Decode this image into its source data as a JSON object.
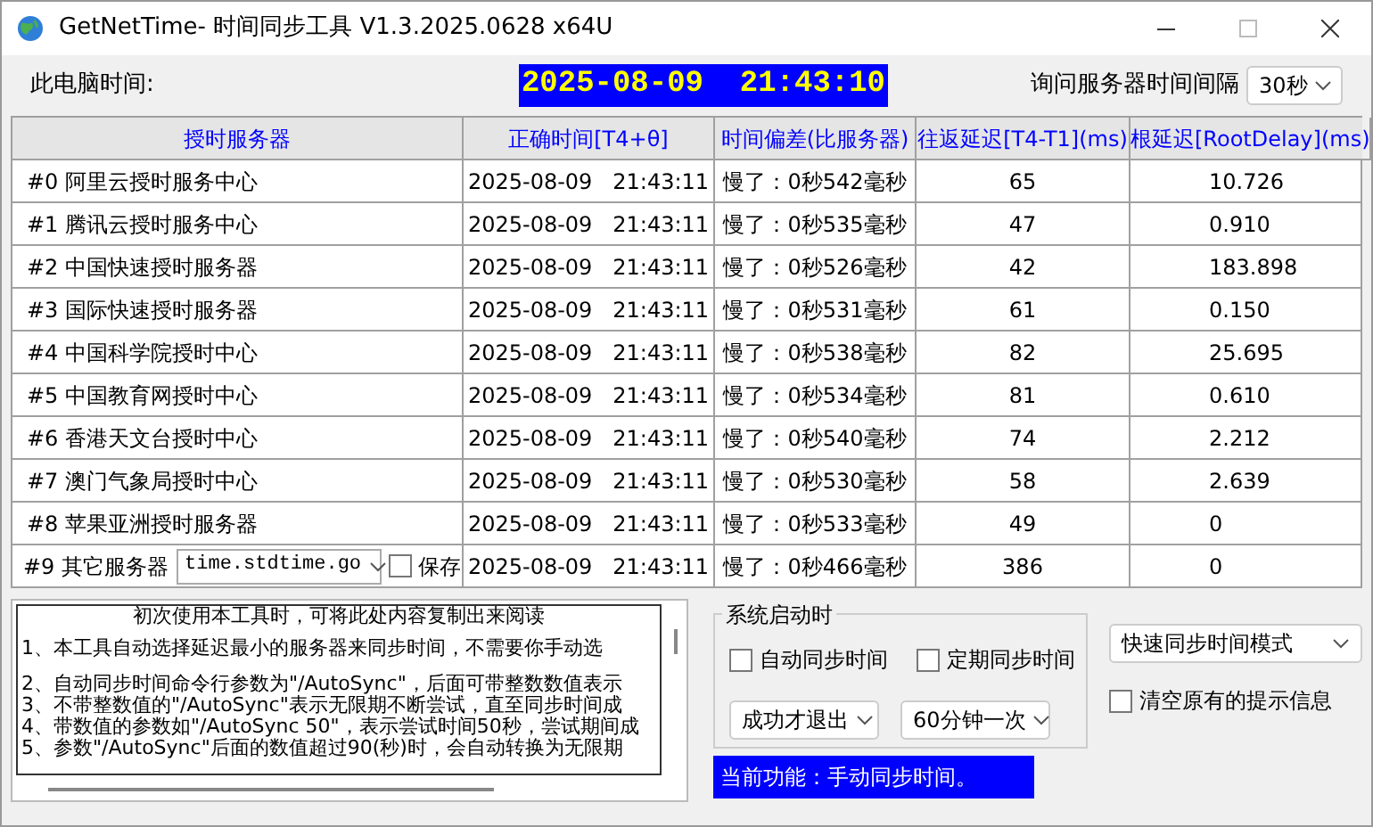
{
  "window": {
    "title": "GetNetTime- 时间同步工具 V1.3.2025.0628 x64U"
  },
  "clock": {
    "label": "此电脑时间:",
    "time": "2025-08-09  21:43:10"
  },
  "interval": {
    "label": "询问服务器时间间隔",
    "value": "30秒"
  },
  "table": {
    "columns": [
      "授时服务器",
      "正确时间[T4+θ]",
      "时间偏差(比服务器)",
      "往返延迟[T4-T1](ms)",
      "根延迟[RootDelay](ms)"
    ],
    "rows": [
      {
        "kind": "fixed",
        "server": "#0 阿里云授时服务中心",
        "time": "2025-08-09   21:43:11",
        "offset": "慢了：0秒542毫秒",
        "rtt": "65",
        "root_delay": "10.726"
      },
      {
        "kind": "fixed",
        "server": "#1 腾讯云授时服务中心",
        "time": "2025-08-09   21:43:11",
        "offset": "慢了：0秒535毫秒",
        "rtt": "47",
        "root_delay": "0.910"
      },
      {
        "kind": "fixed",
        "server": "#2 中国快速授时服务器",
        "time": "2025-08-09   21:43:11",
        "offset": "慢了：0秒526毫秒",
        "rtt": "42",
        "root_delay": "183.898"
      },
      {
        "kind": "fixed",
        "server": "#3 国际快速授时服务器",
        "time": "2025-08-09   21:43:11",
        "offset": "慢了：0秒531毫秒",
        "rtt": "61",
        "root_delay": "0.150"
      },
      {
        "kind": "fixed",
        "server": "#4 中国科学院授时中心",
        "time": "2025-08-09   21:43:11",
        "offset": "慢了：0秒538毫秒",
        "rtt": "82",
        "root_delay": "25.695"
      },
      {
        "kind": "fixed",
        "server": "#5 中国教育网授时中心",
        "time": "2025-08-09   21:43:11",
        "offset": "慢了：0秒534毫秒",
        "rtt": "81",
        "root_delay": "0.610"
      },
      {
        "kind": "fixed",
        "server": "#6 香港天文台授时中心",
        "time": "2025-08-09   21:43:11",
        "offset": "慢了：0秒540毫秒",
        "rtt": "74",
        "root_delay": "2.212"
      },
      {
        "kind": "fixed",
        "server": "#7 澳门气象局授时中心",
        "time": "2025-08-09   21:43:11",
        "offset": "慢了：0秒530毫秒",
        "rtt": "58",
        "root_delay": "2.639"
      },
      {
        "kind": "fixed",
        "server": "#8 苹果亚洲授时服务器",
        "time": "2025-08-09   21:43:11",
        "offset": "慢了：0秒533毫秒",
        "rtt": "49",
        "root_delay": "0"
      },
      {
        "kind": "custom",
        "server": "#9 其它服务器",
        "host": "time.stdtime.go",
        "save_label": "保存",
        "save_checked": false,
        "time": "2025-08-09   21:43:11",
        "offset": "慢了：0秒466毫秒",
        "rtt": "386",
        "root_delay": "0"
      }
    ]
  },
  "notes": {
    "heading": "初次使用本工具时，可将此处内容复制出来阅读",
    "lines": [
      "1、本工具自动选择延迟最小的服务器来同步时间，不需要你手动选",
      "2、自动同步时间命令行参数为\"/AutoSync\"，后面可带整数数值表示",
      "3、不带整数值的\"/AutoSync\"表示无限期不断尝试，直至同步时间成",
      "4、带数值的参数如\"/AutoSync 50\"，表示尝试时间50秒，尝试期间成",
      "5、参数\"/AutoSync\"后面的数值超过90(秒)时，会自动转换为无限期"
    ]
  },
  "startup": {
    "title": "系统启动时",
    "options": [
      {
        "label": "自动同步时间",
        "checked": false
      },
      {
        "label": "定期同步时间",
        "checked": false
      }
    ],
    "selects": [
      "成功才退出",
      "60分钟一次"
    ]
  },
  "mode": {
    "value": "快速同步时间模式"
  },
  "clear_option": {
    "label": "清空原有的提示信息",
    "checked": false
  },
  "status": {
    "text": "当前功能：手动同步时间。"
  }
}
